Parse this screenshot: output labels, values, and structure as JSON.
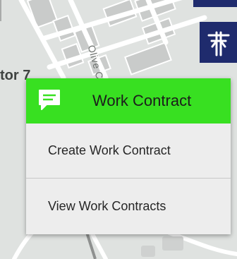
{
  "map": {
    "road_label": "Olive County Road",
    "sector_label": "tor 7"
  },
  "toolbar": {
    "utility_pole_icon": "utility-pole-icon"
  },
  "menu": {
    "header_title": "Work Contract",
    "header_icon": "message-icon",
    "items": [
      {
        "label": "Create Work Contract"
      },
      {
        "label": "View Work Contracts"
      }
    ]
  },
  "colors": {
    "header_green": "#38e021",
    "toolbar_navy": "#1f2b6d",
    "menu_background": "#ededed"
  }
}
